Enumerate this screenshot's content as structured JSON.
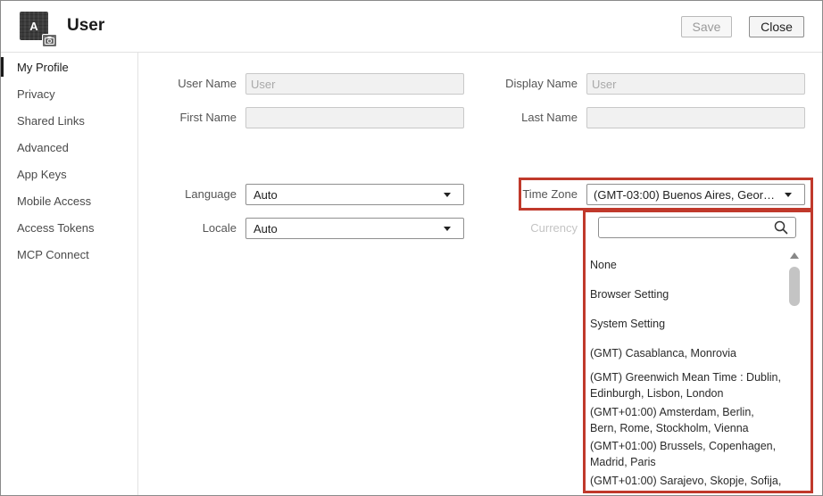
{
  "header": {
    "avatar_letter": "A",
    "title": "User",
    "save_label": "Save",
    "close_label": "Close"
  },
  "sidebar": {
    "items": [
      {
        "label": "My Profile"
      },
      {
        "label": "Privacy"
      },
      {
        "label": "Shared Links"
      },
      {
        "label": "Advanced"
      },
      {
        "label": "App Keys"
      },
      {
        "label": "Mobile Access"
      },
      {
        "label": "Access Tokens"
      },
      {
        "label": "MCP Connect"
      }
    ]
  },
  "form": {
    "user_name": {
      "label": "User Name",
      "value": "User"
    },
    "display_name": {
      "label": "Display Name",
      "value": "User"
    },
    "first_name": {
      "label": "First Name",
      "value": ""
    },
    "last_name": {
      "label": "Last Name",
      "value": ""
    },
    "language": {
      "label": "Language",
      "value": "Auto"
    },
    "locale": {
      "label": "Locale",
      "value": "Auto"
    },
    "time_zone": {
      "label": "Time Zone",
      "value": "(GMT-03:00) Buenos Aires, Geor…"
    },
    "currency": {
      "label": "Currency"
    }
  },
  "timezone_dropdown": {
    "search_value": "",
    "options": [
      {
        "line1": "None"
      },
      {
        "line1": "Browser Setting"
      },
      {
        "line1": "System Setting"
      },
      {
        "line1": "(GMT) Casablanca, Monrovia"
      },
      {
        "line1": "(GMT) Greenwich Mean Time : Dublin,",
        "line2": "Edinburgh, Lisbon, London"
      },
      {
        "line1": "(GMT+01:00) Amsterdam, Berlin,",
        "line2": "Bern, Rome, Stockholm, Vienna"
      },
      {
        "line1": "(GMT+01:00) Brussels, Copenhagen,",
        "line2": "Madrid, Paris"
      },
      {
        "line1": "(GMT+01:00) Sarajevo, Skopje, Sofija,"
      }
    ]
  },
  "colors": {
    "highlight": "#c0392b",
    "active_nav_bar": "#1a1a1a"
  }
}
